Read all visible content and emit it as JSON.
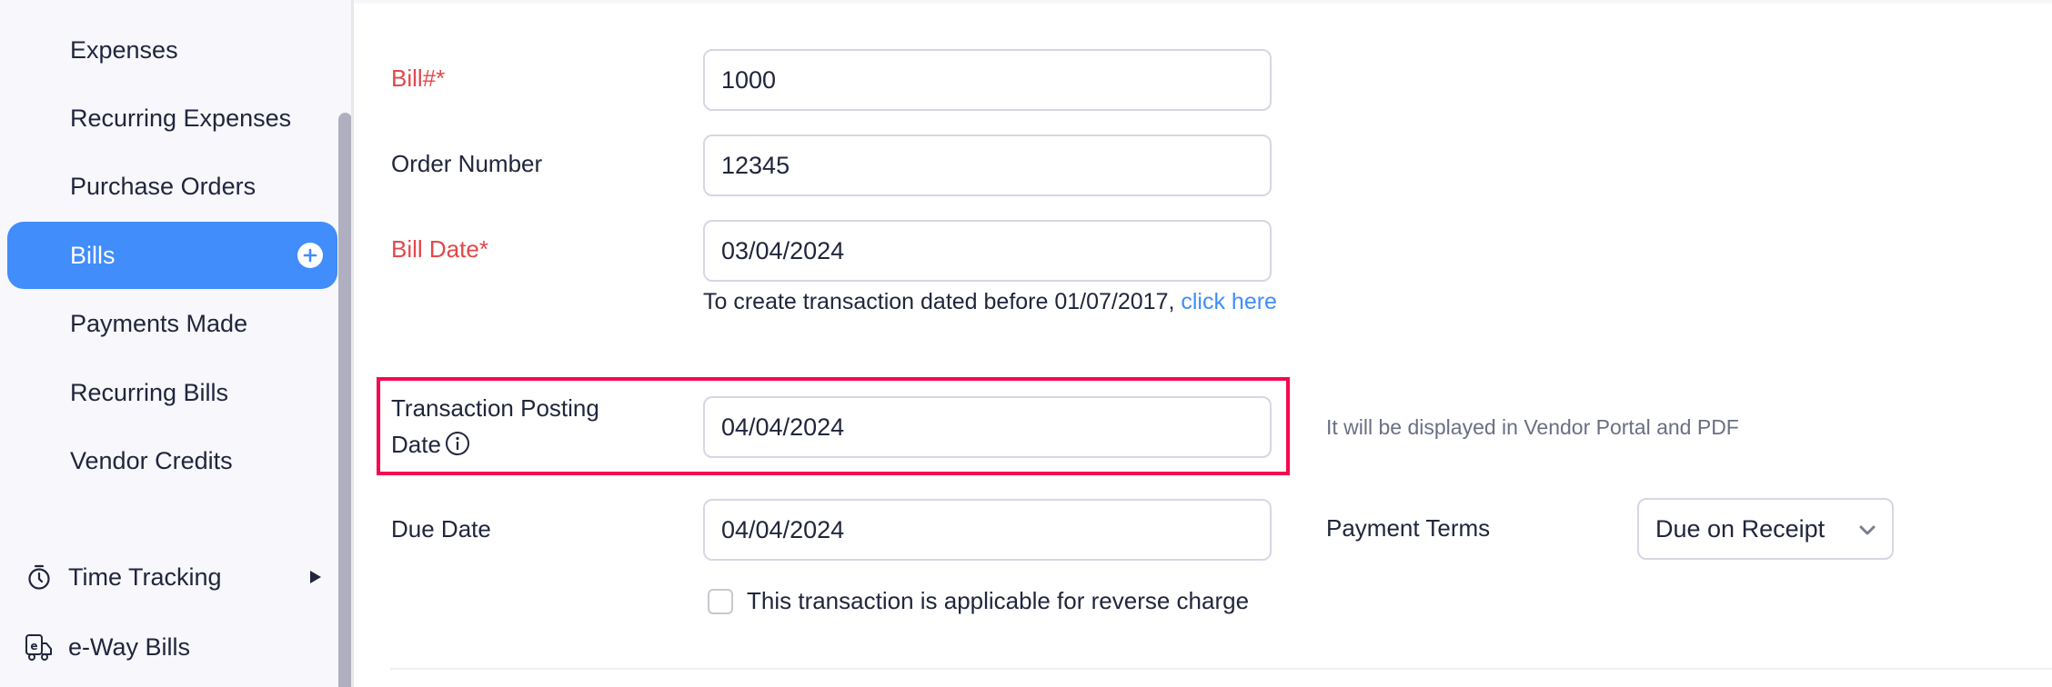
{
  "sidebar": {
    "items": [
      {
        "label": "Expenses",
        "active": false
      },
      {
        "label": "Recurring Expenses",
        "active": false
      },
      {
        "label": "Purchase Orders",
        "active": false
      },
      {
        "label": "Bills",
        "active": true,
        "action_icon": "plus-circle-icon"
      },
      {
        "label": "Payments Made",
        "active": false
      },
      {
        "label": "Recurring Bills",
        "active": false
      },
      {
        "label": "Vendor Credits",
        "active": false
      }
    ],
    "groups": [
      {
        "label": "Time Tracking",
        "icon": "stopwatch-icon",
        "expandable": true
      },
      {
        "label": "e-Way Bills",
        "icon": "eway-truck-icon",
        "expandable": false
      }
    ]
  },
  "form": {
    "bill_number": {
      "label": "Bill#*",
      "value": "1000",
      "required": true
    },
    "order_number": {
      "label": "Order Number",
      "value": "12345",
      "required": false
    },
    "bill_date": {
      "label": "Bill Date*",
      "value": "03/04/2024",
      "required": true,
      "hint_text": "To create transaction dated before 01/07/2017, ",
      "hint_link": "click here"
    },
    "posting_date": {
      "label": "Transaction Posting Date",
      "value": "04/04/2024",
      "note": "It will be displayed in Vendor Portal and PDF",
      "highlighted": true
    },
    "due_date": {
      "label": "Due Date",
      "value": "04/04/2024"
    },
    "payment_terms": {
      "label": "Payment Terms",
      "selected": "Due on Receipt"
    },
    "reverse_charge": {
      "label": "This transaction is applicable for reverse charge",
      "checked": false
    }
  },
  "colors": {
    "accent": "#408dfb",
    "required": "#e2474a",
    "highlight": "#f5084f",
    "sidebar_bg": "#f7f7fc"
  }
}
